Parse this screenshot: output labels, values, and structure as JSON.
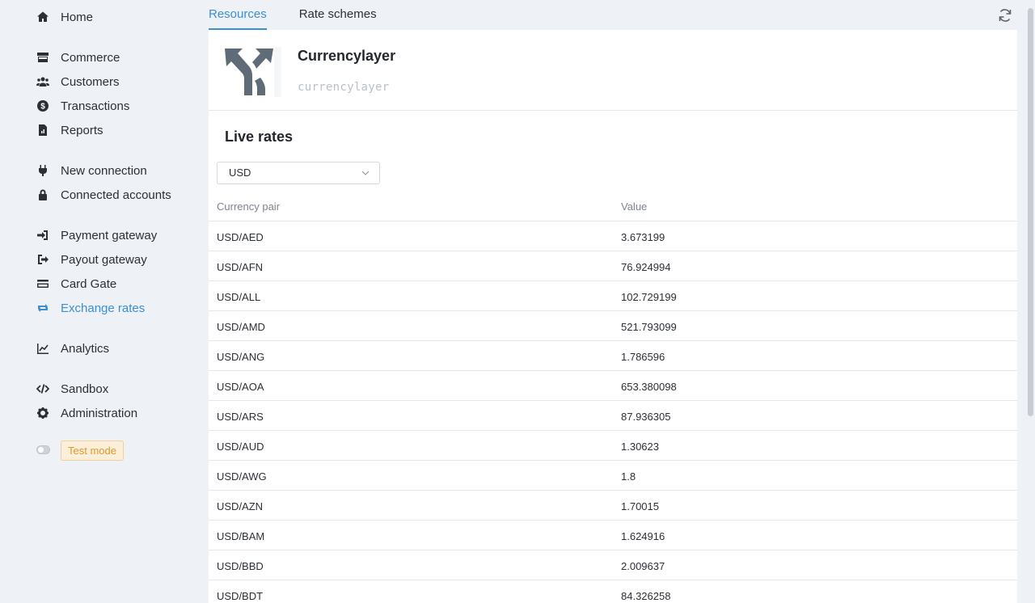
{
  "sidebar": {
    "items": [
      {
        "label": "Home",
        "icon": "home-icon"
      },
      {
        "label": "Commerce",
        "icon": "store-icon"
      },
      {
        "label": "Customers",
        "icon": "users-icon"
      },
      {
        "label": "Transactions",
        "icon": "dollar-circle-icon"
      },
      {
        "label": "Reports",
        "icon": "file-icon"
      },
      {
        "label": "New connection",
        "icon": "plug-icon"
      },
      {
        "label": "Connected accounts",
        "icon": "lock-icon"
      },
      {
        "label": "Payment gateway",
        "icon": "sign-in-icon"
      },
      {
        "label": "Payout gateway",
        "icon": "sign-out-icon"
      },
      {
        "label": "Card Gate",
        "icon": "credit-card-icon"
      },
      {
        "label": "Exchange rates",
        "icon": "exchange-icon"
      },
      {
        "label": "Analytics",
        "icon": "chart-line-icon"
      },
      {
        "label": "Sandbox",
        "icon": "code-icon"
      },
      {
        "label": "Administration",
        "icon": "gear-icon"
      }
    ],
    "active_label": "Exchange rates",
    "test_mode_label": "Test mode"
  },
  "tabs": {
    "resources": "Resources",
    "rate_schemes": "Rate schemes"
  },
  "resource": {
    "title": "Currencylayer",
    "code": "currencylayer"
  },
  "live_rates": {
    "title": "Live rates",
    "currency_select": "USD",
    "columns": {
      "pair": "Currency pair",
      "value": "Value"
    },
    "rows": [
      {
        "pair": "USD/AED",
        "value": "3.673199"
      },
      {
        "pair": "USD/AFN",
        "value": "76.924994"
      },
      {
        "pair": "USD/ALL",
        "value": "102.729199"
      },
      {
        "pair": "USD/AMD",
        "value": "521.793099"
      },
      {
        "pair": "USD/ANG",
        "value": "1.786596"
      },
      {
        "pair": "USD/AOA",
        "value": "653.380098"
      },
      {
        "pair": "USD/ARS",
        "value": "87.936305"
      },
      {
        "pair": "USD/AUD",
        "value": "1.30623"
      },
      {
        "pair": "USD/AWG",
        "value": "1.8"
      },
      {
        "pair": "USD/AZN",
        "value": "1.70015"
      },
      {
        "pair": "USD/BAM",
        "value": "1.624916"
      },
      {
        "pair": "USD/BBD",
        "value": "2.009637"
      },
      {
        "pair": "USD/BDT",
        "value": "84.326258"
      }
    ]
  },
  "colors": {
    "accent": "#3b8fd3",
    "test_mode": "#e09a2e"
  }
}
